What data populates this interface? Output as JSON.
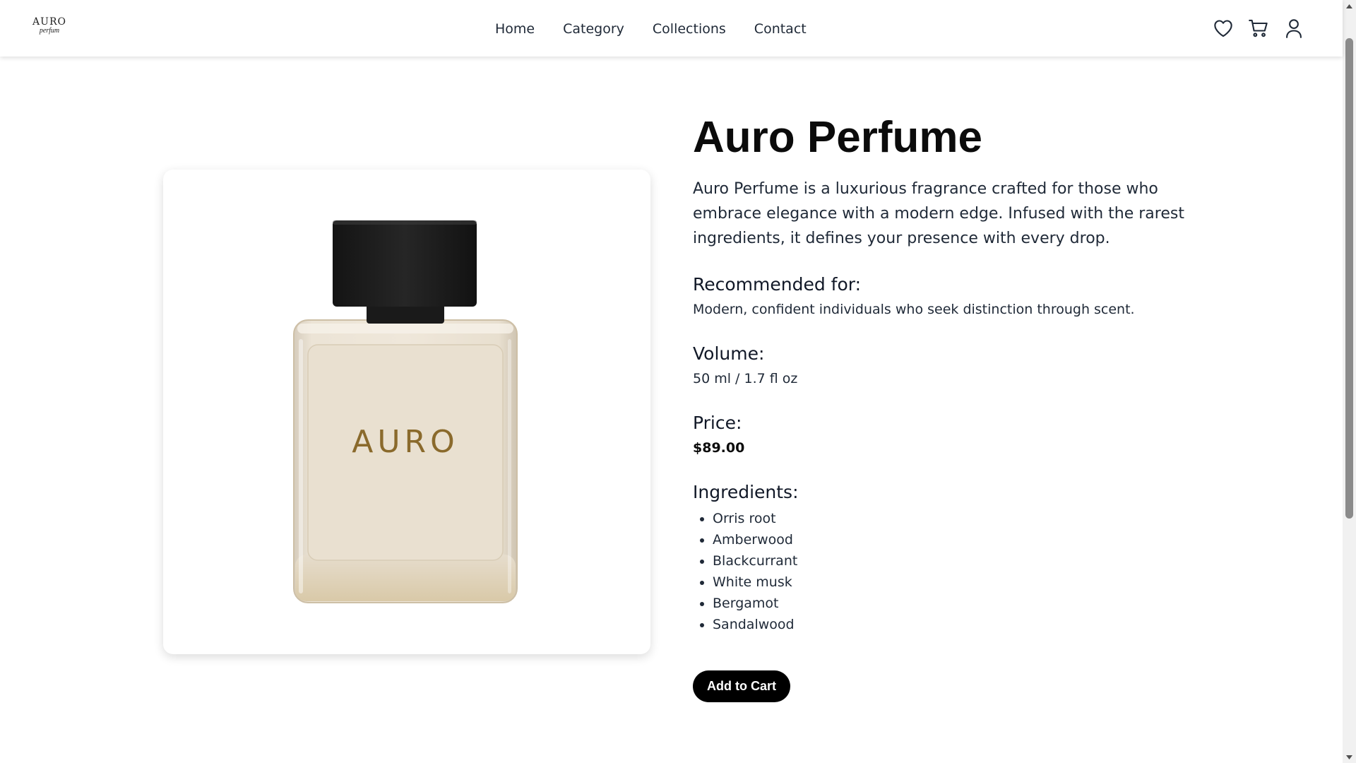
{
  "brand": {
    "logo_top": "AURO",
    "logo_bottom": "perfum"
  },
  "nav": {
    "items": [
      {
        "label": "Home"
      },
      {
        "label": "Category"
      },
      {
        "label": "Collections"
      },
      {
        "label": "Contact"
      }
    ]
  },
  "header_icons": [
    "heart-icon",
    "cart-icon",
    "user-icon"
  ],
  "product": {
    "image_label": "AURO",
    "title": "Auro Perfume",
    "description": "Auro Perfume is a luxurious fragrance crafted for those who embrace elegance with a modern edge. Infused with the rarest ingredients, it defines your presence with every drop.",
    "recommended_label": "Recommended for:",
    "recommended_value": "Modern, confident individuals who seek distinction through scent.",
    "volume_label": "Volume:",
    "volume_value": "50 ml / 1.7 fl oz",
    "price_label": "Price:",
    "price_value": "$89.00",
    "ingredients_label": "Ingredients:",
    "ingredients": [
      "Orris root",
      "Amberwood",
      "Blackcurrant",
      "White musk",
      "Bergamot",
      "Sandalwood"
    ],
    "add_to_cart": "Add to Cart"
  },
  "colors": {
    "button_bg": "#000000",
    "button_text": "#ffffff",
    "bottle_glass": "#ece3d4",
    "bottle_cap": "#1c1c1c",
    "bottle_label": "#8a6a2c"
  }
}
